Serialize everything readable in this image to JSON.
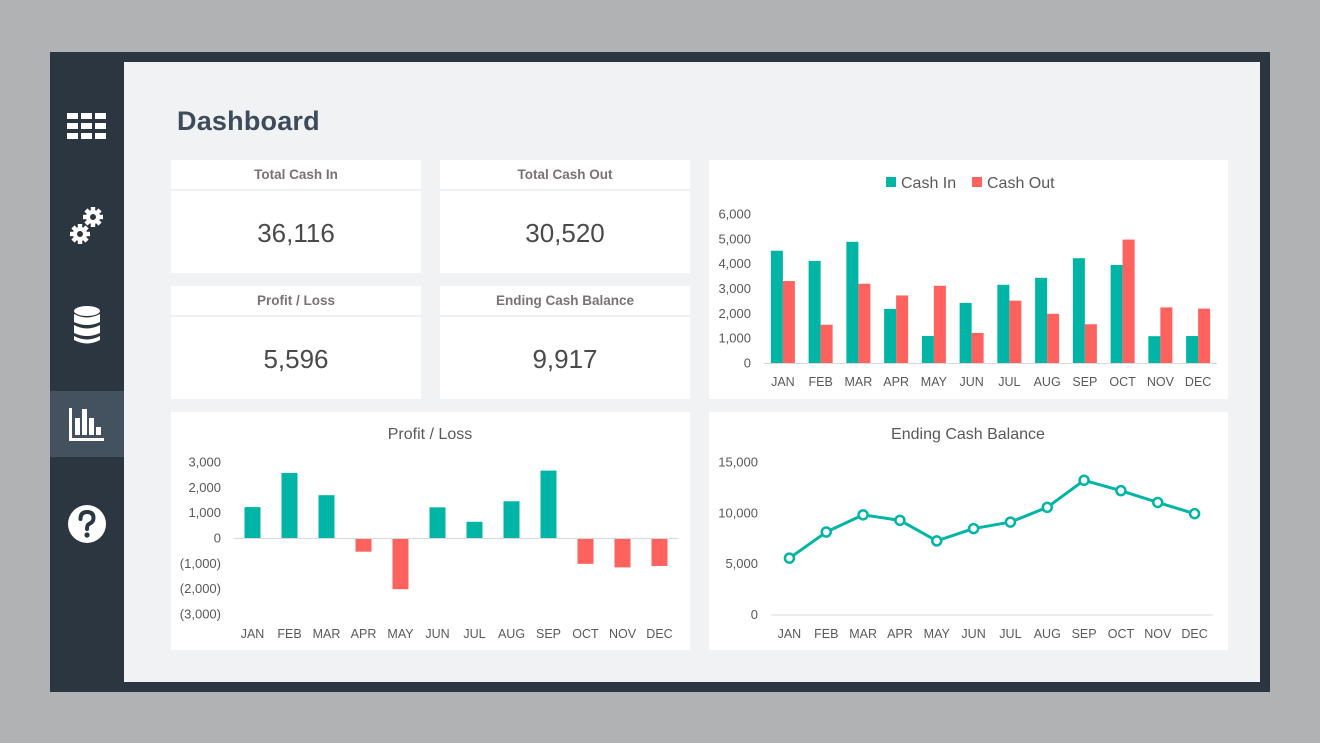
{
  "sidebar": {
    "items": [
      {
        "name": "grid-menu",
        "icon": "grid-icon",
        "active": false
      },
      {
        "name": "settings",
        "icon": "gears-icon",
        "active": false
      },
      {
        "name": "database",
        "icon": "database-icon",
        "active": false
      },
      {
        "name": "dashboard",
        "icon": "bar-chart-icon",
        "active": true
      },
      {
        "name": "help",
        "icon": "question-circle-icon",
        "active": false
      }
    ]
  },
  "page": {
    "title": "Dashboard"
  },
  "kpis": {
    "total_cash_in": {
      "label": "Total Cash In",
      "value": "36,116"
    },
    "total_cash_out": {
      "label": "Total Cash Out",
      "value": "30,520"
    },
    "profit_loss": {
      "label": "Profit / Loss",
      "value": "5,596"
    },
    "ending_cash_balance": {
      "label": "Ending Cash Balance",
      "value": "9,917"
    }
  },
  "colors": {
    "cash_in": "#00b5a5",
    "cash_out": "#fd625e",
    "line": "#00b5a5",
    "axis": "#d9d9d9",
    "text": "#595959"
  },
  "chart_data": [
    {
      "id": "cash-flow",
      "type": "bar",
      "title": "",
      "categories": [
        "JAN",
        "FEB",
        "MAR",
        "APR",
        "MAY",
        "JUN",
        "JUL",
        "AUG",
        "SEP",
        "OCT",
        "NOV",
        "DEC"
      ],
      "series": [
        {
          "name": "Cash In",
          "values": [
            4520,
            4110,
            4880,
            2180,
            1090,
            2420,
            3150,
            3430,
            4220,
            3950,
            1080,
            1086
          ]
        },
        {
          "name": "Cash Out",
          "values": [
            3300,
            1540,
            3190,
            2720,
            3110,
            1210,
            2510,
            1980,
            1560,
            4970,
            2240,
            2190
          ]
        }
      ],
      "yticks": [
        "0",
        "1,000",
        "2,000",
        "3,000",
        "4,000",
        "5,000",
        "6,000"
      ],
      "ylim": [
        0,
        6000
      ],
      "legend": "top",
      "grid": false
    },
    {
      "id": "profit-loss",
      "type": "bar",
      "title": "Profit / Loss",
      "categories": [
        "JAN",
        "FEB",
        "MAR",
        "APR",
        "MAY",
        "JUN",
        "JUL",
        "AUG",
        "SEP",
        "OCT",
        "NOV",
        "DEC"
      ],
      "values": [
        1220,
        2570,
        1690,
        -540,
        -2020,
        1210,
        640,
        1450,
        2660,
        -1020,
        -1160,
        -1104
      ],
      "yticks": [
        "(3,000)",
        "(2,000)",
        "(1,000)",
        "0",
        "1,000",
        "2,000",
        "3,000"
      ],
      "ylim": [
        -3000,
        3000
      ],
      "grid": false
    },
    {
      "id": "ending-cash-balance",
      "type": "line",
      "title": "Ending Cash Balance",
      "categories": [
        "JAN",
        "FEB",
        "MAR",
        "APR",
        "MAY",
        "JUN",
        "JUL",
        "AUG",
        "SEP",
        "OCT",
        "NOV",
        "DEC"
      ],
      "values": [
        5541,
        8111,
        9801,
        9261,
        7241,
        8451,
        9091,
        10541,
        13201,
        12181,
        11021,
        9917
      ],
      "yticks": [
        "0",
        "5,000",
        "10,000",
        "15,000"
      ],
      "ylim": [
        0,
        15000
      ],
      "grid": false
    }
  ]
}
